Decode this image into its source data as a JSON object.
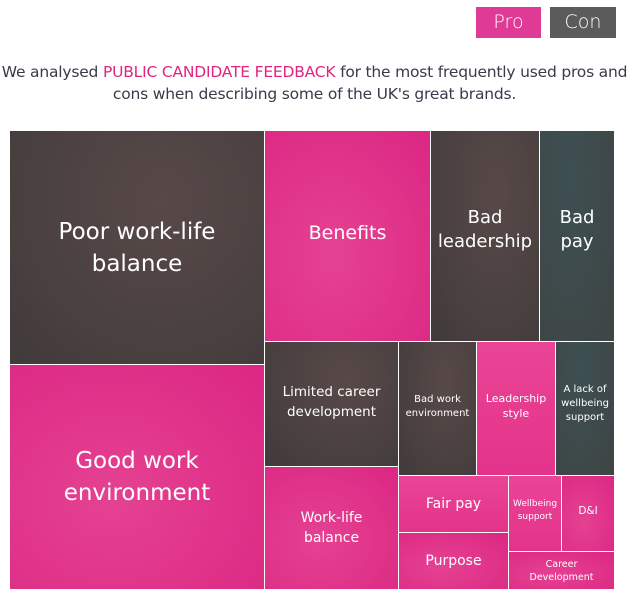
{
  "toggle": {
    "pro_label": "Pro",
    "con_label": "Con",
    "pro_color": "#e03a97",
    "con_color": "#5b5b5b"
  },
  "intro": {
    "part1": "We analysed ",
    "highlight": "PUBLIC CANDIDATE FEEDBACK",
    "part2": " for the most frequently used pros and cons when describing some of the UK's great brands.",
    "highlight_color": "#e0257f"
  },
  "treemap": {
    "cells": [
      {
        "label": "Poor work-life balance",
        "type": "con"
      },
      {
        "label": "Good work environment",
        "type": "pro"
      },
      {
        "label": "Benefits",
        "type": "pro"
      },
      {
        "label": "Bad leadership",
        "type": "con"
      },
      {
        "label": "Bad pay",
        "type": "con"
      },
      {
        "label": "Limited career development",
        "type": "con"
      },
      {
        "label": "Bad work environment",
        "type": "con"
      },
      {
        "label": "Leadership style",
        "type": "pro"
      },
      {
        "label": "A lack of wellbeing support",
        "type": "con"
      },
      {
        "label": "Work-life balance",
        "type": "pro"
      },
      {
        "label": "Fair pay",
        "type": "pro"
      },
      {
        "label": "Purpose",
        "type": "pro"
      },
      {
        "label": "Wellbeing support",
        "type": "pro"
      },
      {
        "label": "D&I",
        "type": "pro"
      },
      {
        "label": "Career Development",
        "type": "pro"
      }
    ]
  }
}
